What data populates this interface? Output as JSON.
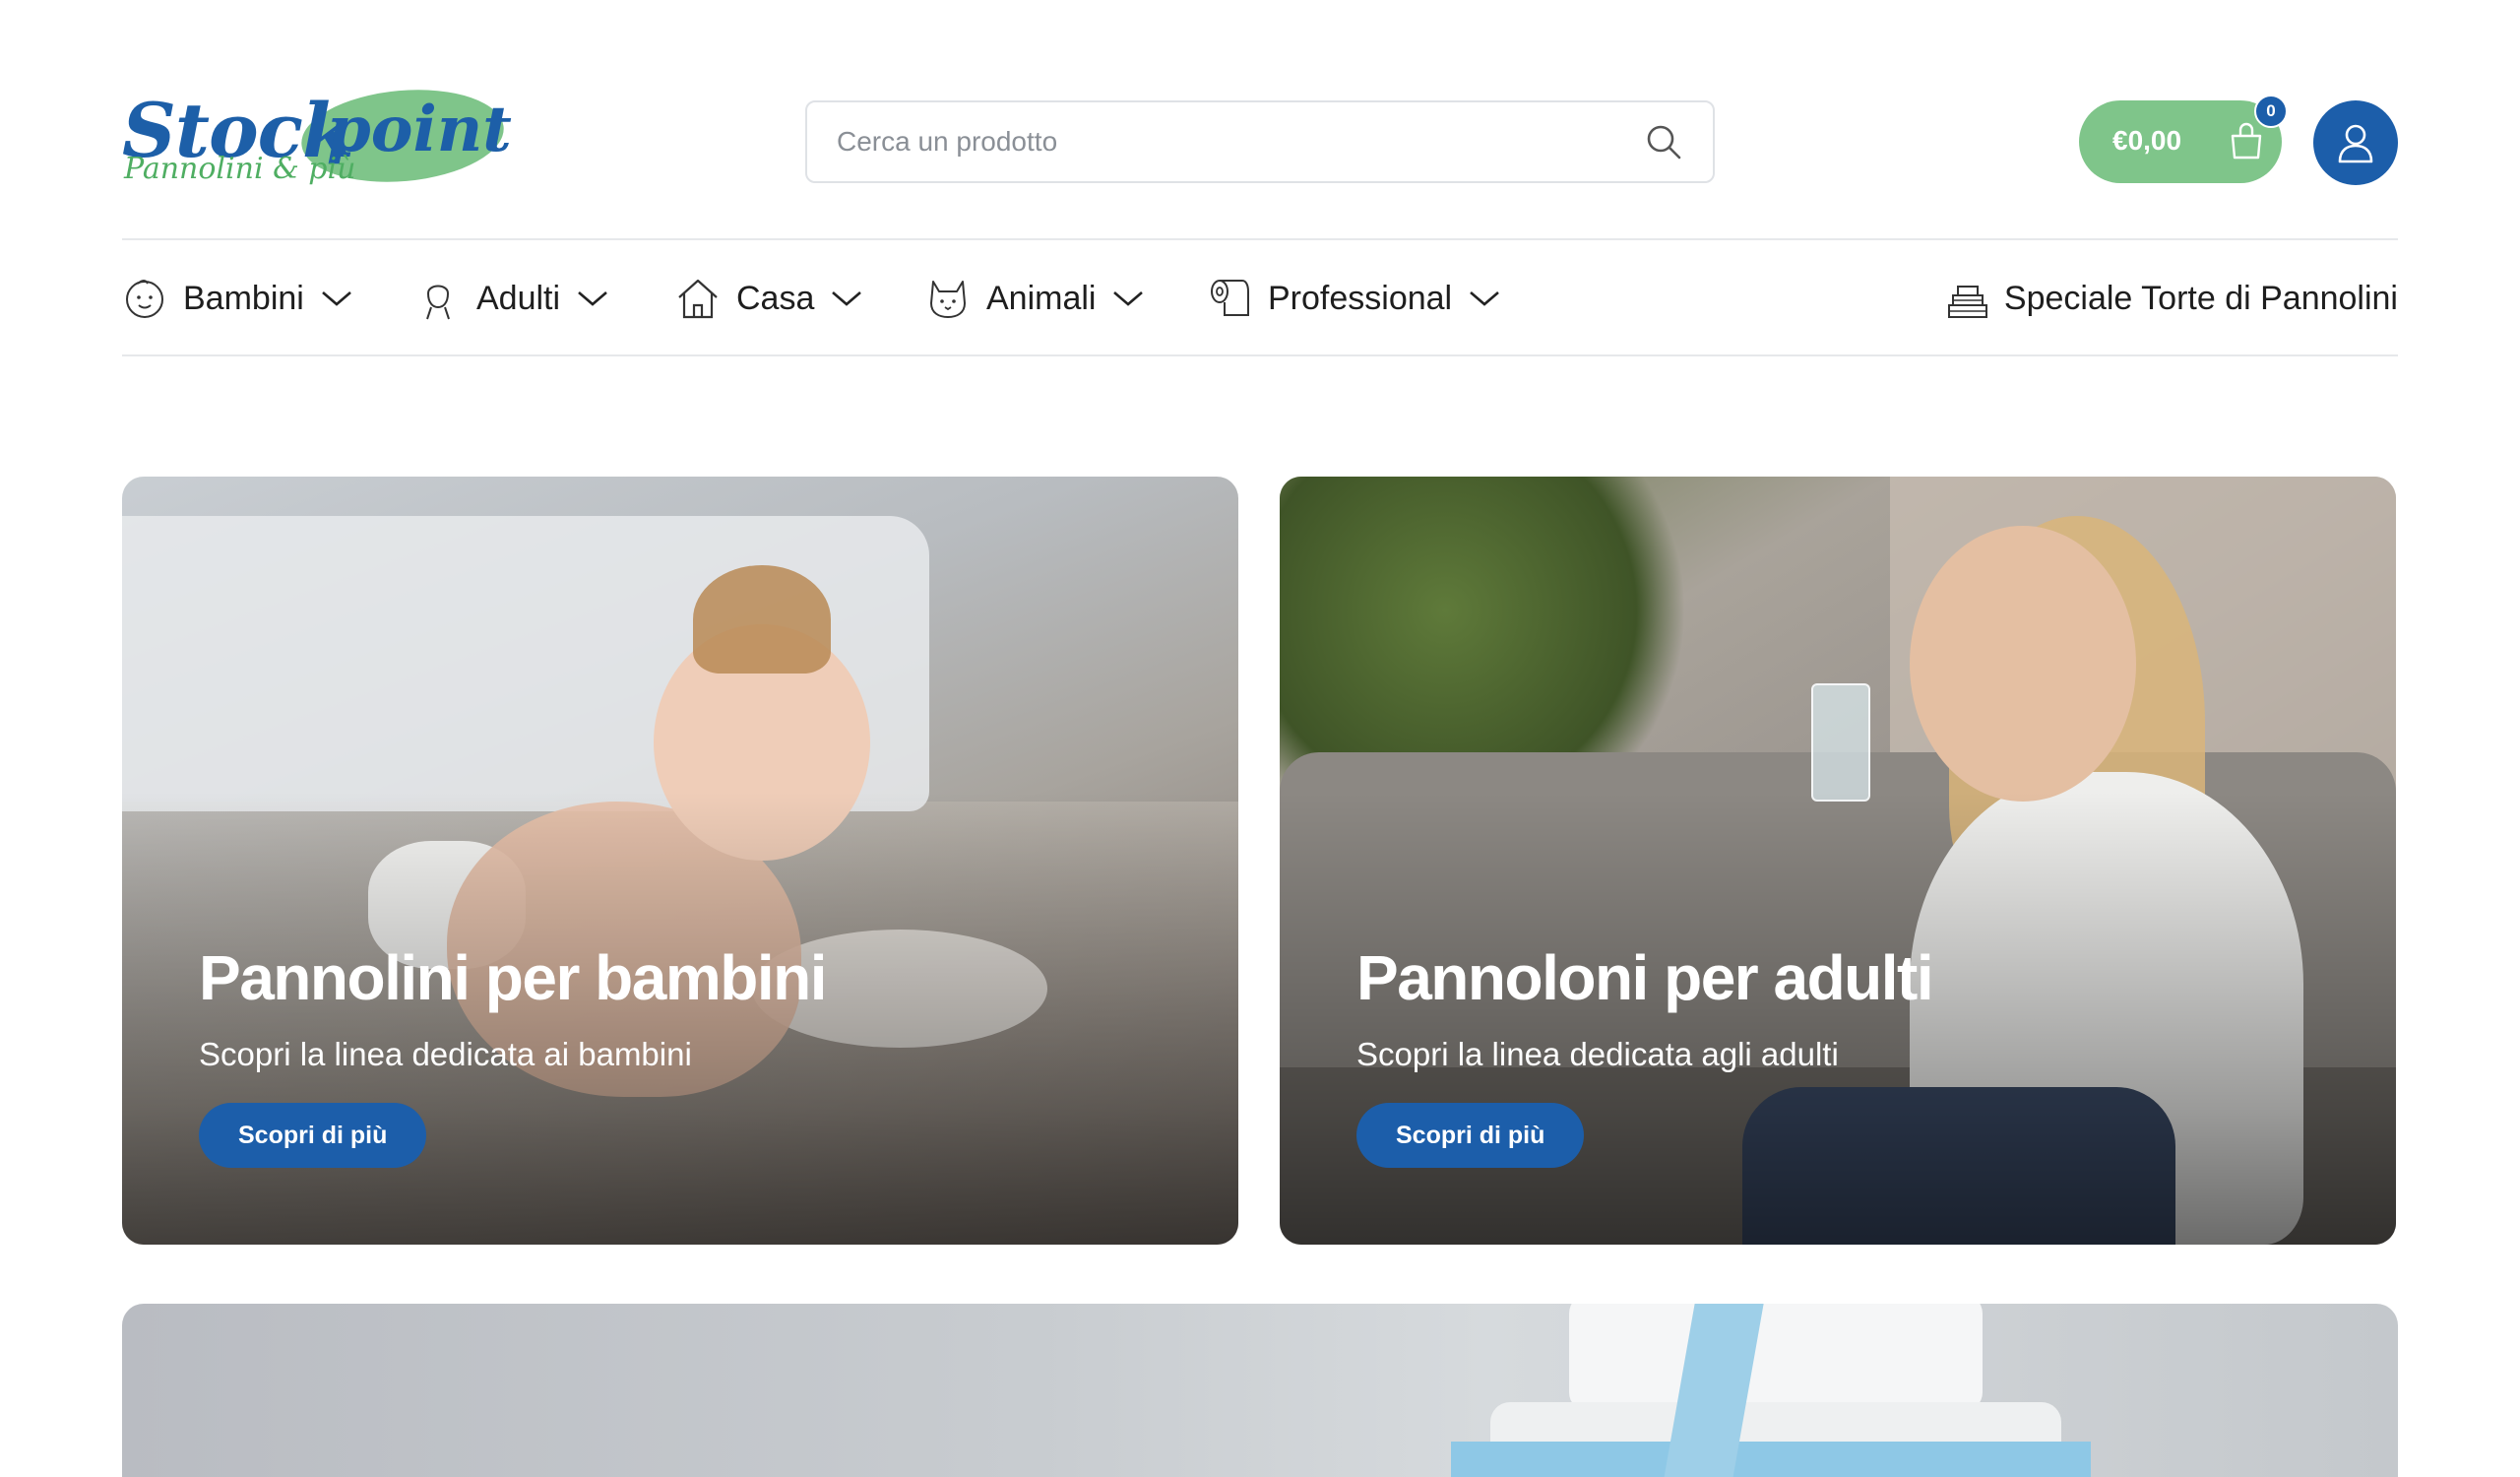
{
  "logo": {
    "word1": "Stock",
    "word2": "point",
    "tagline": "Pannolini & più"
  },
  "search": {
    "placeholder": "Cerca un prodotto"
  },
  "cart": {
    "amount": "€0,00",
    "count": "0"
  },
  "nav": {
    "items": [
      {
        "label": "Bambini",
        "icon": "baby-face-icon"
      },
      {
        "label": "Adulti",
        "icon": "person-icon"
      },
      {
        "label": "Casa",
        "icon": "house-icon"
      },
      {
        "label": "Animali",
        "icon": "cat-icon"
      },
      {
        "label": "Professional",
        "icon": "paper-roll-icon"
      }
    ],
    "special": {
      "label": "Speciale Torte di Pannolini",
      "icon": "cake-icon"
    }
  },
  "cards": [
    {
      "title": "Pannolini per bambini",
      "subtitle": "Scopri la linea dedicata ai bambini",
      "button": "Scopri di più"
    },
    {
      "title": "Pannoloni per adulti",
      "subtitle": "Scopri la linea dedicata agli adulti",
      "button": "Scopri di più"
    }
  ],
  "colors": {
    "brand_blue": "#1c5eaa",
    "brand_green": "#7fc58a",
    "logo_green_text": "#4fae62"
  }
}
